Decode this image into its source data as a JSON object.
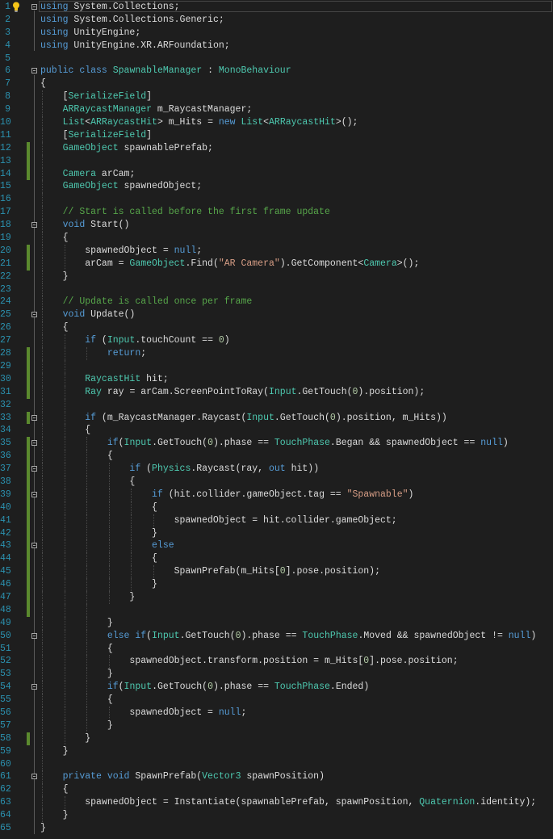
{
  "editor": {
    "current_line": 1,
    "change_color": "#5b8a2e",
    "lines": [
      {
        "n": "1",
        "fold": true,
        "tokens": [
          [
            "k",
            "using"
          ],
          [
            "p",
            " System.Collections;"
          ]
        ]
      },
      {
        "n": "2",
        "tokens": [
          [
            "k",
            "using"
          ],
          [
            "p",
            " System.Collections.Generic;"
          ]
        ]
      },
      {
        "n": "3",
        "tokens": [
          [
            "k",
            "using"
          ],
          [
            "p",
            " UnityEngine;"
          ]
        ]
      },
      {
        "n": "4",
        "tokens": [
          [
            "k",
            "using"
          ],
          [
            "p",
            " UnityEngine.XR.ARFoundation;"
          ]
        ]
      },
      {
        "n": "5",
        "tokens": []
      },
      {
        "n": "6",
        "fold": true,
        "tokens": [
          [
            "k",
            "public"
          ],
          [
            "p",
            " "
          ],
          [
            "k",
            "class"
          ],
          [
            "p",
            " "
          ],
          [
            "t",
            "SpawnableManager"
          ],
          [
            "p",
            " : "
          ],
          [
            "t",
            "MonoBehaviour"
          ]
        ]
      },
      {
        "n": "7",
        "tokens": [
          [
            "p",
            "{"
          ]
        ]
      },
      {
        "n": "8",
        "tokens": [
          [
            "p",
            "    ["
          ],
          [
            "t",
            "SerializeField"
          ],
          [
            "p",
            "]"
          ]
        ]
      },
      {
        "n": "9",
        "tokens": [
          [
            "p",
            "    "
          ],
          [
            "t",
            "ARRaycastManager"
          ],
          [
            "p",
            " m_RaycastManager;"
          ]
        ]
      },
      {
        "n": "10",
        "tokens": [
          [
            "p",
            "    "
          ],
          [
            "t",
            "List"
          ],
          [
            "p",
            "<"
          ],
          [
            "t",
            "ARRaycastHit"
          ],
          [
            "p",
            "> m_Hits = "
          ],
          [
            "k",
            "new"
          ],
          [
            "p",
            " "
          ],
          [
            "t",
            "List"
          ],
          [
            "p",
            "<"
          ],
          [
            "t",
            "ARRaycastHit"
          ],
          [
            "p",
            ">();"
          ]
        ]
      },
      {
        "n": "11",
        "tokens": [
          [
            "p",
            "    ["
          ],
          [
            "t",
            "SerializeField"
          ],
          [
            "p",
            "]"
          ]
        ]
      },
      {
        "n": "12",
        "changed": true,
        "tokens": [
          [
            "p",
            "    "
          ],
          [
            "t",
            "GameObject"
          ],
          [
            "p",
            " spawnablePrefab;"
          ]
        ]
      },
      {
        "n": "13",
        "changed": true,
        "tokens": []
      },
      {
        "n": "14",
        "changed": true,
        "tokens": [
          [
            "p",
            "    "
          ],
          [
            "t",
            "Camera"
          ],
          [
            "p",
            " arCam;"
          ]
        ]
      },
      {
        "n": "15",
        "tokens": [
          [
            "p",
            "    "
          ],
          [
            "t",
            "GameObject"
          ],
          [
            "p",
            " spawnedObject;"
          ]
        ]
      },
      {
        "n": "16",
        "tokens": []
      },
      {
        "n": "17",
        "tokens": [
          [
            "p",
            "    "
          ],
          [
            "c",
            "// Start is called before the first frame update"
          ]
        ]
      },
      {
        "n": "18",
        "fold": true,
        "tokens": [
          [
            "p",
            "    "
          ],
          [
            "k",
            "void"
          ],
          [
            "p",
            " Start()"
          ]
        ]
      },
      {
        "n": "19",
        "tokens": [
          [
            "p",
            "    {"
          ]
        ]
      },
      {
        "n": "20",
        "changed": true,
        "tokens": [
          [
            "p",
            "        spawnedObject = "
          ],
          [
            "k",
            "null"
          ],
          [
            "p",
            ";"
          ]
        ]
      },
      {
        "n": "21",
        "changed": true,
        "tokens": [
          [
            "p",
            "        arCam = "
          ],
          [
            "t",
            "GameObject"
          ],
          [
            "p",
            ".Find("
          ],
          [
            "s",
            "\"AR Camera\""
          ],
          [
            "p",
            ").GetComponent<"
          ],
          [
            "t",
            "Camera"
          ],
          [
            "p",
            ">();"
          ]
        ]
      },
      {
        "n": "22",
        "tokens": [
          [
            "p",
            "    }"
          ]
        ]
      },
      {
        "n": "23",
        "tokens": []
      },
      {
        "n": "24",
        "tokens": [
          [
            "p",
            "    "
          ],
          [
            "c",
            "// Update is called once per frame"
          ]
        ]
      },
      {
        "n": "25",
        "fold": true,
        "tokens": [
          [
            "p",
            "    "
          ],
          [
            "k",
            "void"
          ],
          [
            "p",
            " Update()"
          ]
        ]
      },
      {
        "n": "26",
        "tokens": [
          [
            "p",
            "    {"
          ]
        ]
      },
      {
        "n": "27",
        "tokens": [
          [
            "p",
            "        "
          ],
          [
            "k",
            "if"
          ],
          [
            "p",
            " ("
          ],
          [
            "t",
            "Input"
          ],
          [
            "p",
            ".touchCount == "
          ],
          [
            "n",
            "0"
          ],
          [
            "p",
            ")"
          ]
        ]
      },
      {
        "n": "28",
        "changed": true,
        "tokens": [
          [
            "p",
            "            "
          ],
          [
            "k",
            "return"
          ],
          [
            "p",
            ";"
          ]
        ]
      },
      {
        "n": "29",
        "changed": true,
        "tokens": []
      },
      {
        "n": "30",
        "changed": true,
        "tokens": [
          [
            "p",
            "        "
          ],
          [
            "t",
            "RaycastHit"
          ],
          [
            "p",
            " hit;"
          ]
        ]
      },
      {
        "n": "31",
        "changed": true,
        "tokens": [
          [
            "p",
            "        "
          ],
          [
            "t",
            "Ray"
          ],
          [
            "p",
            " ray = arCam.ScreenPointToRay("
          ],
          [
            "t",
            "Input"
          ],
          [
            "p",
            ".GetTouch("
          ],
          [
            "n",
            "0"
          ],
          [
            "p",
            ").position);"
          ]
        ]
      },
      {
        "n": "32",
        "tokens": []
      },
      {
        "n": "33",
        "fold": true,
        "changed": true,
        "tokens": [
          [
            "p",
            "        "
          ],
          [
            "k",
            "if"
          ],
          [
            "p",
            " (m_RaycastManager.Raycast("
          ],
          [
            "t",
            "Input"
          ],
          [
            "p",
            ".GetTouch("
          ],
          [
            "n",
            "0"
          ],
          [
            "p",
            ").position, m_Hits))"
          ]
        ]
      },
      {
        "n": "34",
        "tokens": [
          [
            "p",
            "        {"
          ]
        ]
      },
      {
        "n": "35",
        "fold": true,
        "changed": true,
        "tokens": [
          [
            "p",
            "            "
          ],
          [
            "k",
            "if"
          ],
          [
            "p",
            "("
          ],
          [
            "t",
            "Input"
          ],
          [
            "p",
            ".GetTouch("
          ],
          [
            "n",
            "0"
          ],
          [
            "p",
            ").phase == "
          ],
          [
            "t",
            "TouchPhase"
          ],
          [
            "p",
            ".Began && spawnedObject == "
          ],
          [
            "k",
            "null"
          ],
          [
            "p",
            ")"
          ]
        ]
      },
      {
        "n": "36",
        "changed": true,
        "tokens": [
          [
            "p",
            "            {"
          ]
        ]
      },
      {
        "n": "37",
        "fold": true,
        "changed": true,
        "tokens": [
          [
            "p",
            "                "
          ],
          [
            "k",
            "if"
          ],
          [
            "p",
            " ("
          ],
          [
            "t",
            "Physics"
          ],
          [
            "p",
            ".Raycast(ray, "
          ],
          [
            "k",
            "out"
          ],
          [
            "p",
            " hit))"
          ]
        ]
      },
      {
        "n": "38",
        "changed": true,
        "tokens": [
          [
            "p",
            "                {"
          ]
        ]
      },
      {
        "n": "39",
        "fold": true,
        "changed": true,
        "tokens": [
          [
            "p",
            "                    "
          ],
          [
            "k",
            "if"
          ],
          [
            "p",
            " (hit.collider.gameObject.tag == "
          ],
          [
            "s",
            "\"Spawnable\""
          ],
          [
            "p",
            ")"
          ]
        ]
      },
      {
        "n": "40",
        "changed": true,
        "tokens": [
          [
            "p",
            "                    {"
          ]
        ]
      },
      {
        "n": "41",
        "changed": true,
        "tokens": [
          [
            "p",
            "                        spawnedObject = hit.collider.gameObject;"
          ]
        ]
      },
      {
        "n": "42",
        "changed": true,
        "tokens": [
          [
            "p",
            "                    }"
          ]
        ]
      },
      {
        "n": "43",
        "fold": true,
        "changed": true,
        "tokens": [
          [
            "p",
            "                    "
          ],
          [
            "k",
            "else"
          ]
        ]
      },
      {
        "n": "44",
        "changed": true,
        "tokens": [
          [
            "p",
            "                    {"
          ]
        ]
      },
      {
        "n": "45",
        "changed": true,
        "tokens": [
          [
            "p",
            "                        SpawnPrefab(m_Hits["
          ],
          [
            "n",
            "0"
          ],
          [
            "p",
            "].pose.position);"
          ]
        ]
      },
      {
        "n": "46",
        "changed": true,
        "tokens": [
          [
            "p",
            "                    }"
          ]
        ]
      },
      {
        "n": "47",
        "changed": true,
        "tokens": [
          [
            "p",
            "                }"
          ]
        ]
      },
      {
        "n": "48",
        "changed": true,
        "tokens": []
      },
      {
        "n": "49",
        "tokens": [
          [
            "p",
            "            }"
          ]
        ]
      },
      {
        "n": "50",
        "fold": true,
        "tokens": [
          [
            "p",
            "            "
          ],
          [
            "k",
            "else"
          ],
          [
            "p",
            " "
          ],
          [
            "k",
            "if"
          ],
          [
            "p",
            "("
          ],
          [
            "t",
            "Input"
          ],
          [
            "p",
            ".GetTouch("
          ],
          [
            "n",
            "0"
          ],
          [
            "p",
            ").phase == "
          ],
          [
            "t",
            "TouchPhase"
          ],
          [
            "p",
            ".Moved && spawnedObject != "
          ],
          [
            "k",
            "null"
          ],
          [
            "p",
            ")"
          ]
        ]
      },
      {
        "n": "51",
        "tokens": [
          [
            "p",
            "            {"
          ]
        ]
      },
      {
        "n": "52",
        "tokens": [
          [
            "p",
            "                spawnedObject.transform.position = m_Hits["
          ],
          [
            "n",
            "0"
          ],
          [
            "p",
            "].pose.position;"
          ]
        ]
      },
      {
        "n": "53",
        "tokens": [
          [
            "p",
            "            }"
          ]
        ]
      },
      {
        "n": "54",
        "fold": true,
        "tokens": [
          [
            "p",
            "            "
          ],
          [
            "k",
            "if"
          ],
          [
            "p",
            "("
          ],
          [
            "t",
            "Input"
          ],
          [
            "p",
            ".GetTouch("
          ],
          [
            "n",
            "0"
          ],
          [
            "p",
            ").phase == "
          ],
          [
            "t",
            "TouchPhase"
          ],
          [
            "p",
            ".Ended)"
          ]
        ]
      },
      {
        "n": "55",
        "tokens": [
          [
            "p",
            "            {"
          ]
        ]
      },
      {
        "n": "56",
        "tokens": [
          [
            "p",
            "                spawnedObject = "
          ],
          [
            "k",
            "null"
          ],
          [
            "p",
            ";"
          ]
        ]
      },
      {
        "n": "57",
        "tokens": [
          [
            "p",
            "            }"
          ]
        ]
      },
      {
        "n": "58",
        "changed": true,
        "tokens": [
          [
            "p",
            "        }"
          ]
        ]
      },
      {
        "n": "59",
        "tokens": [
          [
            "p",
            "    }"
          ]
        ]
      },
      {
        "n": "60",
        "tokens": []
      },
      {
        "n": "61",
        "fold": true,
        "tokens": [
          [
            "p",
            "    "
          ],
          [
            "k",
            "private"
          ],
          [
            "p",
            " "
          ],
          [
            "k",
            "void"
          ],
          [
            "p",
            " SpawnPrefab("
          ],
          [
            "t",
            "Vector3"
          ],
          [
            "p",
            " spawnPosition)"
          ]
        ]
      },
      {
        "n": "62",
        "tokens": [
          [
            "p",
            "    {"
          ]
        ]
      },
      {
        "n": "63",
        "tokens": [
          [
            "p",
            "        spawnedObject = Instantiate(spawnablePrefab, spawnPosition, "
          ],
          [
            "t",
            "Quaternion"
          ],
          [
            "p",
            ".identity);"
          ]
        ]
      },
      {
        "n": "64",
        "tokens": [
          [
            "p",
            "    }"
          ]
        ]
      },
      {
        "n": "65",
        "tokens": [
          [
            "p",
            "}"
          ]
        ]
      }
    ]
  }
}
